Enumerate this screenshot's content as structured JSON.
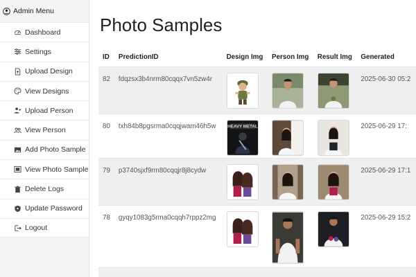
{
  "sidebar": {
    "header": "Admin Menu",
    "items": [
      {
        "label": "Dashboard",
        "icon": "dashboard-icon"
      },
      {
        "label": "Settings",
        "icon": "sliders-icon"
      },
      {
        "label": "Upload Design",
        "icon": "file-upload-icon"
      },
      {
        "label": "View Designs",
        "icon": "palette-icon"
      },
      {
        "label": "Upload Person",
        "icon": "person-add-icon"
      },
      {
        "label": "View Person",
        "icon": "people-icon"
      },
      {
        "label": "Add Photo Sample",
        "icon": "image-add-icon"
      },
      {
        "label": "View Photo Sample",
        "icon": "image-view-icon"
      },
      {
        "label": "Delete Logs",
        "icon": "trash-icon"
      },
      {
        "label": "Update Password",
        "icon": "shield-icon"
      },
      {
        "label": "Logout",
        "icon": "logout-icon"
      }
    ]
  },
  "page": {
    "title": "Photo Samples"
  },
  "table": {
    "headers": [
      "ID",
      "PredictionID",
      "Design Img",
      "Person Img",
      "Result Img",
      "Generated"
    ],
    "rows": [
      {
        "id": "82",
        "prediction_id": "fdqzsx3b4nrm80cqqx7vn5zw4r",
        "generated": "2025-06-30 05:2"
      },
      {
        "id": "80",
        "prediction_id": "txh84b8pgsrma0cqqjwam46h5w",
        "generated": "2025-06-29 17:"
      },
      {
        "id": "79",
        "prediction_id": "p3740sjxf9rm80cqqjr8j8cydw",
        "generated": "2025-06-29 17:1"
      },
      {
        "id": "78",
        "prediction_id": "gyqy1083g5rma0cqqh7rppz2mg",
        "generated": "2025-06-29 15:2"
      }
    ]
  },
  "colors": {
    "sidebar_bg": "#f3f4f6",
    "row_stripe": "#efefef"
  }
}
